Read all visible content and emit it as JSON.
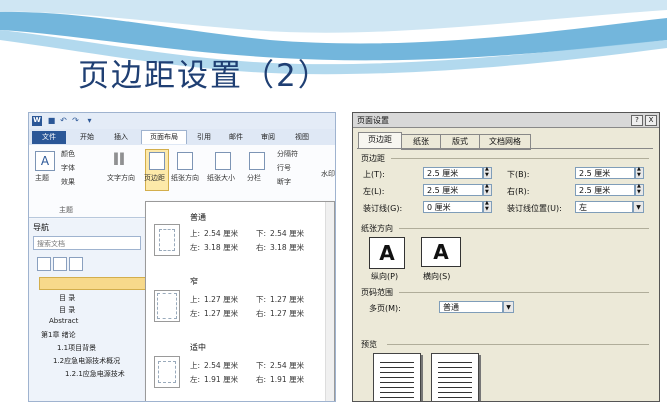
{
  "slide": {
    "title": "页边距设置（2）"
  },
  "word": {
    "logo_letter": "W",
    "tabs": [
      "文件",
      "开始",
      "插入",
      "页面布局",
      "引用",
      "邮件",
      "审阅",
      "视图"
    ],
    "ribbon": {
      "theme_label": "主题",
      "colors": "颜色",
      "fonts": "字体",
      "effects": "效果",
      "text_direction": "文字方向",
      "margins": "页边距",
      "orientation": "纸张方向",
      "size": "纸张大小",
      "columns": "分栏",
      "breaks": "分隔符",
      "line_numbers": "行号",
      "hyphenation": "断字",
      "watermark": "水印",
      "group_theme": "主题"
    },
    "nav": {
      "title": "导航",
      "search_placeholder": "搜索文档",
      "items": [
        "目  录",
        "目  录",
        "Abstract",
        "第1章  绪论",
        "1.1项目背景",
        "1.2应急电源技术概况",
        "1.2.1应急电源技术"
      ]
    },
    "margins_menu": {
      "presets": [
        {
          "name": "普通",
          "top_label": "上:",
          "top": "2.54 厘米",
          "bottom_label": "下:",
          "bottom": "2.54 厘米",
          "left_label": "左:",
          "left": "3.18 厘米",
          "right_label": "右:",
          "right": "3.18 厘米"
        },
        {
          "name": "窄",
          "top_label": "上:",
          "top": "1.27 厘米",
          "bottom_label": "下:",
          "bottom": "1.27 厘米",
          "left_label": "左:",
          "left": "1.27 厘米",
          "right_label": "右:",
          "right": "1.27 厘米"
        },
        {
          "name": "适中",
          "top_label": "上:",
          "top": "2.54 厘米",
          "bottom_label": "下:",
          "bottom": "2.54 厘米",
          "left_label": "左:",
          "left": "1.91 厘米",
          "right_label": "右:",
          "right": "1.91 厘米"
        }
      ]
    }
  },
  "dialog": {
    "title": "页面设置",
    "help_btn": "?",
    "close_btn": "X",
    "tabs": [
      "页边距",
      "纸张",
      "版式",
      "文档网格"
    ],
    "margins_section": "页边距",
    "top_label": "上(T):",
    "top_value": "2.5 厘米",
    "bottom_label": "下(B):",
    "bottom_value": "2.5 厘米",
    "left_label": "左(L):",
    "left_value": "2.5 厘米",
    "right_label": "右(R):",
    "right_value": "2.5 厘米",
    "gutter_label": "装订线(G):",
    "gutter_value": "0 厘米",
    "gutter_pos_label": "装订线位置(U):",
    "gutter_pos_value": "左",
    "orientation_section": "纸张方向",
    "portrait_label": "纵向(P)",
    "landscape_label": "横向(S)",
    "portrait_glyph": "A",
    "landscape_glyph": "A",
    "pages_section": "页码范围",
    "multi_pages_label": "多页(M):",
    "multi_pages_value": "普通",
    "preview_section": "预览"
  }
}
